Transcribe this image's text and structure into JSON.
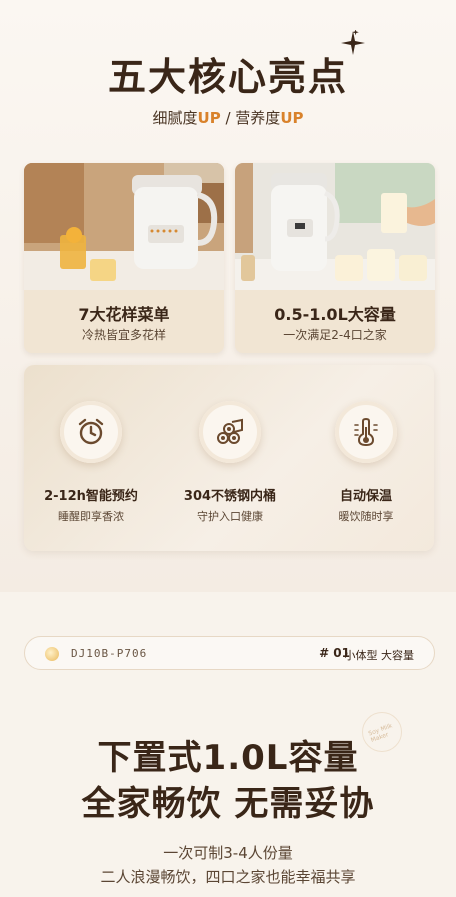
{
  "header": {
    "title": "五大核心亮点",
    "subtitle_a": "细腻度",
    "subtitle_a_up": "UP",
    "subtitle_sep": " / ",
    "subtitle_b": "营养度",
    "subtitle_b_up": "UP"
  },
  "cards": [
    {
      "title": "7大花样菜单",
      "desc": "冷热皆宜多花样",
      "brand": "Midea"
    },
    {
      "title": "0.5-1.0L大容量",
      "desc": "一次满足2-4口之家",
      "brand": "Midea"
    }
  ],
  "features": [
    {
      "icon": "alarm-clock-icon",
      "title": "2-12h智能预约",
      "desc": "睡醒即享香浓"
    },
    {
      "icon": "steel-pipes-icon",
      "title": "304不锈钢内桶",
      "desc": "守护入口健康"
    },
    {
      "icon": "thermometer-icon",
      "title": "自动保温",
      "desc": "暖饮随时享"
    }
  ],
  "model_bar": {
    "model": "DJ10B-P706",
    "index": "# 01",
    "tag": "小体型 大容量"
  },
  "capacity": {
    "stamp": "Soy Milk Maker",
    "headline_1": "下置式1.0L容量",
    "headline_2": "全家畅饮 无需妥协",
    "line_1": "一次可制3-4人份量",
    "line_2": "二人浪漫畅饮，四口之家也能幸福共享"
  },
  "colors": {
    "accent_up": "#d9822b",
    "text_dark": "#3a2618",
    "card_bg": "#f1e5d3"
  }
}
